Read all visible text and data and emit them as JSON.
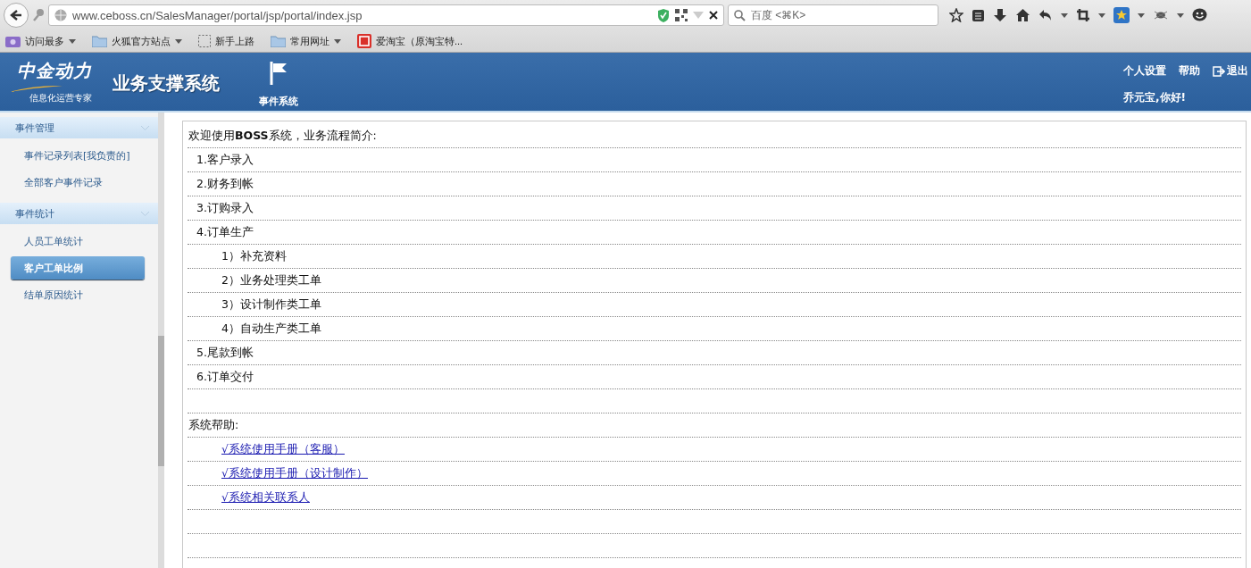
{
  "browser": {
    "url": "www.ceboss.cn/SalesManager/portal/jsp/portal/index.jsp",
    "search_placeholder": "百度 <⌘K>",
    "bookmarks": [
      {
        "label": "访问最多",
        "kind": "smart",
        "dropdown": true
      },
      {
        "label": "火狐官方站点",
        "kind": "folder",
        "dropdown": true
      },
      {
        "label": "新手上路",
        "kind": "page",
        "dropdown": false
      },
      {
        "label": "常用网址",
        "kind": "folder",
        "dropdown": true
      },
      {
        "label": "爱淘宝（原淘宝特...",
        "kind": "site",
        "dropdown": false
      }
    ]
  },
  "header": {
    "logo_text": "中金动力",
    "logo_tagline": "信息化运营专家",
    "title": "业务支撑系统",
    "nav": [
      {
        "label": "事件系统"
      }
    ],
    "links": [
      "个人设置",
      "帮助",
      "退出"
    ],
    "greeting": "乔元宝,你好!"
  },
  "sidebar": {
    "groups": [
      {
        "title": "事件管理",
        "items": [
          {
            "label": "事件记录列表[我负责的]",
            "selected": false
          },
          {
            "label": "全部客户事件记录",
            "selected": false
          }
        ]
      },
      {
        "title": "事件统计",
        "items": [
          {
            "label": "人员工单统计",
            "selected": false
          },
          {
            "label": "客户工单比例",
            "selected": true
          },
          {
            "label": "结单原因统计",
            "selected": false
          }
        ]
      }
    ]
  },
  "content": {
    "intro": "欢迎使用**BOSS**系统，业务流程简介:",
    "steps": [
      {
        "label": "1.客户录入"
      },
      {
        "label": "2.财务到帐"
      },
      {
        "label": "3.订购录入"
      },
      {
        "label": "4.订单生产",
        "children": [
          {
            "label": "1）补充资料"
          },
          {
            "label": "2）业务处理类工单"
          },
          {
            "label": "3）设计制作类工单"
          },
          {
            "label": "4）自动生产类工单"
          }
        ]
      },
      {
        "label": "5.尾款到帐"
      },
      {
        "label": "6.订单交付"
      }
    ],
    "help_title": "系统帮助:",
    "help_links": [
      "√系统使用手册（客服）",
      "√系统使用手册（设计制作）",
      "√系统相关联系人"
    ]
  }
}
